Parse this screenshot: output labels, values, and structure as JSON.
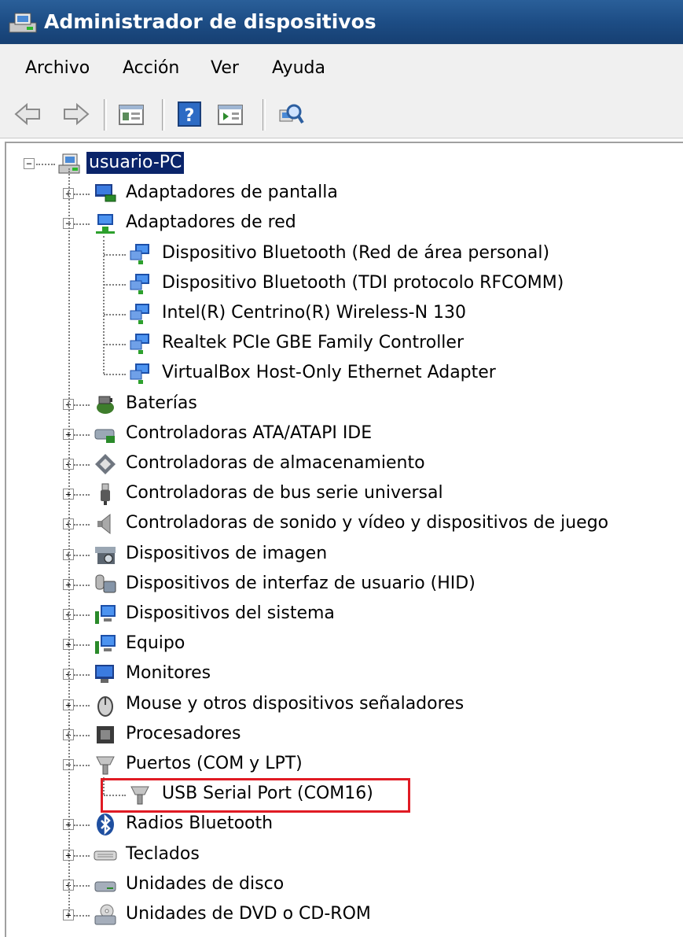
{
  "window": {
    "title": "Administrador de dispositivos"
  },
  "menu": {
    "items": [
      "Archivo",
      "Acción",
      "Ver",
      "Ayuda"
    ]
  },
  "toolbar": {
    "icons": [
      "back-arrow-icon",
      "forward-arrow-icon",
      "properties-icon",
      "help-icon",
      "action-pane-icon",
      "scan-hardware-icon"
    ]
  },
  "tree": {
    "root": {
      "label": "usuario-PC",
      "expanded": true,
      "selected": true
    },
    "categories": [
      {
        "label": "Adaptadores de pantalla",
        "icon": "display-adapter-icon",
        "expanded": false
      },
      {
        "label": "Adaptadores de red",
        "icon": "network-adapter-icon",
        "expanded": true,
        "children": [
          "Dispositivo Bluetooth (Red de área personal)",
          "Dispositivo Bluetooth (TDI protocolo RFCOMM)",
          "Intel(R) Centrino(R) Wireless-N 130",
          "Realtek PCIe GBE Family Controller",
          "VirtualBox Host-Only Ethernet Adapter"
        ]
      },
      {
        "label": "Baterías",
        "icon": "battery-icon",
        "expanded": false
      },
      {
        "label": "Controladoras ATA/ATAPI IDE",
        "icon": "ide-controller-icon",
        "expanded": false
      },
      {
        "label": "Controladoras de almacenamiento",
        "icon": "storage-controller-icon",
        "expanded": false
      },
      {
        "label": "Controladoras de bus serie universal",
        "icon": "usb-controller-icon",
        "expanded": false
      },
      {
        "label": "Controladoras de sonido y vídeo y dispositivos de juego",
        "icon": "speaker-icon",
        "expanded": false
      },
      {
        "label": "Dispositivos de imagen",
        "icon": "camera-icon",
        "expanded": false
      },
      {
        "label": "Dispositivos de interfaz de usuario (HID)",
        "icon": "hid-icon",
        "expanded": false
      },
      {
        "label": "Dispositivos del sistema",
        "icon": "system-device-icon",
        "expanded": false
      },
      {
        "label": "Equipo",
        "icon": "computer-icon",
        "expanded": false
      },
      {
        "label": "Monitores",
        "icon": "monitor-icon",
        "expanded": false
      },
      {
        "label": "Mouse y otros dispositivos señaladores",
        "icon": "mouse-icon",
        "expanded": false
      },
      {
        "label": "Procesadores",
        "icon": "processor-icon",
        "expanded": false
      },
      {
        "label": "Puertos (COM y LPT)",
        "icon": "port-icon",
        "expanded": true,
        "children": [
          "USB Serial Port (COM16)"
        ]
      },
      {
        "label": "Radios Bluetooth",
        "icon": "bluetooth-icon",
        "expanded": false
      },
      {
        "label": "Teclados",
        "icon": "keyboard-icon",
        "expanded": false
      },
      {
        "label": "Unidades de disco",
        "icon": "disk-drive-icon",
        "expanded": false
      },
      {
        "label": "Unidades de DVD o CD-ROM",
        "icon": "dvd-drive-icon",
        "expanded": false
      }
    ]
  },
  "annotation": {
    "highlighted_item": "USB Serial Port (COM16)",
    "color": "#e01b24"
  }
}
